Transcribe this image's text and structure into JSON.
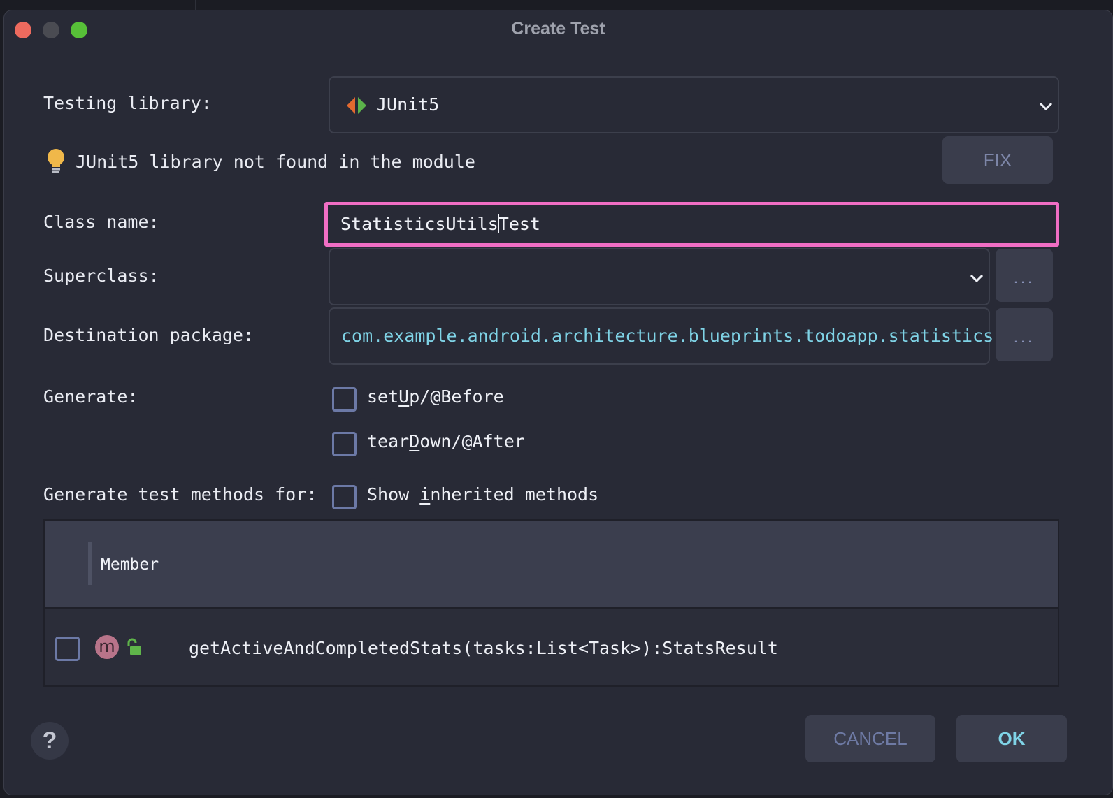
{
  "dialog": {
    "title": "Create Test",
    "testing_library": {
      "label": "Testing library:",
      "value": "JUnit5",
      "icon": "junit5-icon"
    },
    "warning": {
      "text": "JUnit5 library not found in the module",
      "icon": "lightbulb-icon",
      "fix_label": "FIX"
    },
    "class_name": {
      "label": "Class name:",
      "value_before_caret": "StatisticsUtils",
      "value_after_caret": "Test"
    },
    "superclass": {
      "label": "Superclass:",
      "value": "",
      "browse_label": "..."
    },
    "destination_package": {
      "label": "Destination package:",
      "value": "com.example.android.architecture.blueprints.todoapp.statistics",
      "browse_label": "..."
    },
    "generate": {
      "label": "Generate:",
      "setup": {
        "pre": "set",
        "mnemonic": "U",
        "post": "p/@Before",
        "checked": false
      },
      "teardown": {
        "pre": "tear",
        "mnemonic": "D",
        "post": "own/@After",
        "checked": false
      }
    },
    "methods": {
      "label": "Generate test methods for:",
      "show_inherited": {
        "pre": "Show ",
        "mnemonic": "i",
        "post": "nherited methods",
        "checked": false
      },
      "column_header": "Member",
      "rows": [
        {
          "badge": "m",
          "signature": "getActiveAndCompletedStats(tasks:List<Task>):StatsResult",
          "checked": false
        }
      ]
    },
    "buttons": {
      "help": "?",
      "cancel": "CANCEL",
      "ok": "OK"
    },
    "colors": {
      "focus_border": "#f06ec4",
      "package_text": "#7fd3e6",
      "checkbox_border": "#6c79a6",
      "traffic_close": "#ed6a5e",
      "traffic_max": "#57c038"
    }
  }
}
